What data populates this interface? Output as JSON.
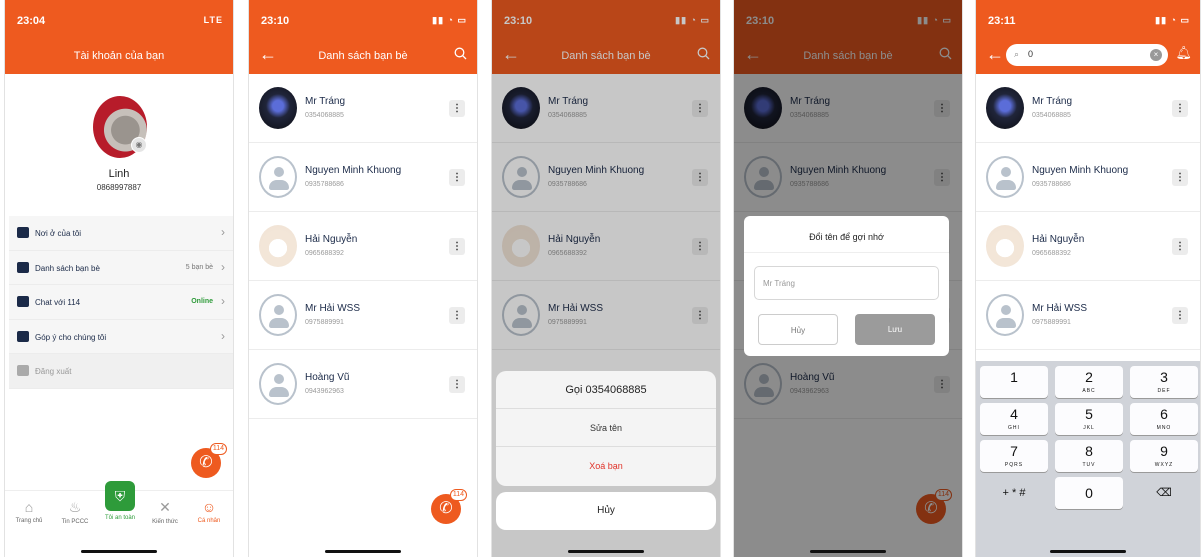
{
  "screens": [
    {
      "time": "23:04",
      "signal": "LTE"
    },
    {
      "time": "23:10",
      "signal": ""
    },
    {
      "time": "23:10",
      "signal": ""
    },
    {
      "time": "23:10",
      "signal": ""
    },
    {
      "time": "23:11",
      "signal": ""
    }
  ],
  "profile": {
    "title": "Tài khoản của bạn",
    "name": "Linh",
    "phone": "0868997887",
    "menu": [
      {
        "label": "Nơi ở của tôi",
        "right": ""
      },
      {
        "label": "Danh sách bạn bè",
        "right": "5 bạn bè"
      },
      {
        "label": "Chat với 114",
        "right": "Online"
      },
      {
        "label": "Góp ý cho chúng tôi",
        "right": ""
      },
      {
        "label": "Đăng xuất",
        "right": ""
      }
    ],
    "tabs": [
      "Trang chủ",
      "Tin PCCC",
      "Tôi an toàn",
      "Kiến thức",
      "Cá nhân"
    ],
    "fab_badge": "114"
  },
  "friends": {
    "title": "Danh sách bạn bè",
    "items": [
      {
        "name": "Mr Tráng",
        "phone": "0354068885"
      },
      {
        "name": "Nguyen Minh Khuong",
        "phone": "0935788686"
      },
      {
        "name": "Hải Nguyễn",
        "phone": "0965688392"
      },
      {
        "name": "Mr Hải WSS",
        "phone": "0975889991"
      },
      {
        "name": "Hoàng Vũ",
        "phone": "0943962963"
      }
    ]
  },
  "action_sheet": {
    "call": "Gọi 0354068885",
    "rename": "Sửa tên",
    "delete": "Xoá bạn",
    "cancel": "Hủy"
  },
  "rename_dialog": {
    "title": "Đổi tên để gợi nhớ",
    "placeholder": "Mr Tráng",
    "cancel": "Hủy",
    "save": "Lưu"
  },
  "search": {
    "query": "0",
    "keys": [
      {
        "num": "1",
        "letters": ""
      },
      {
        "num": "2",
        "letters": "ABC"
      },
      {
        "num": "3",
        "letters": "DEF"
      },
      {
        "num": "4",
        "letters": "GHI"
      },
      {
        "num": "5",
        "letters": "JKL"
      },
      {
        "num": "6",
        "letters": "MNO"
      },
      {
        "num": "7",
        "letters": "PQRS"
      },
      {
        "num": "8",
        "letters": "TUV"
      },
      {
        "num": "9",
        "letters": "WXYZ"
      },
      {
        "num": "0",
        "letters": ""
      }
    ],
    "symbols": "+ * #"
  },
  "colors": {
    "accent": "#ee5a1f",
    "navy": "#1b2a48",
    "green": "#2e9b3a",
    "danger": "#e0332a"
  }
}
